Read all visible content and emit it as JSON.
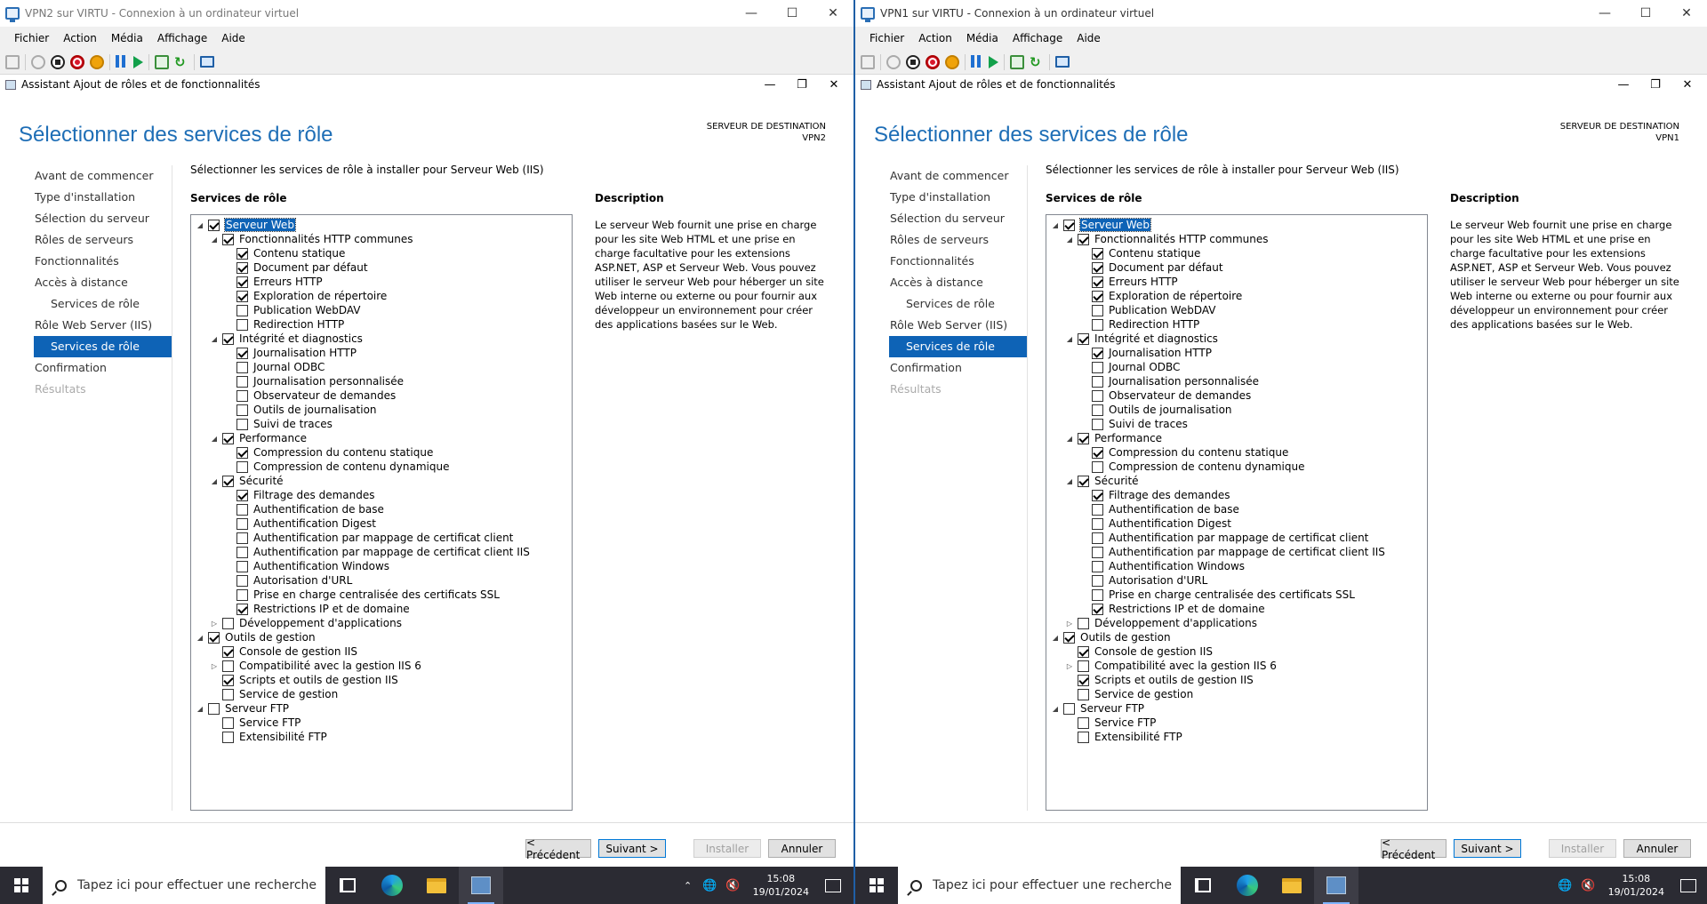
{
  "left": {
    "window_title": "VPN2 sur VIRTU - Connexion à un ordinateur virtuel",
    "menu": [
      "Fichier",
      "Action",
      "Média",
      "Affichage",
      "Aide"
    ],
    "wizard_title": "Assistant Ajout de rôles et de fonctionnalités",
    "page_title": "Sélectionner des services de rôle",
    "dest_label": "SERVEUR DE DESTINATION",
    "dest_server": "VPN2",
    "instruction": "Sélectionner les services de rôle à installer pour Serveur Web (IIS)",
    "services_label": "Services de rôle",
    "description_label": "Description",
    "description_text": "Le serveur Web fournit une prise en charge pour les site Web HTML et une prise en charge facultative pour les extensions ASP.NET, ASP et Serveur Web. Vous pouvez utiliser le serveur Web pour héberger un site Web interne ou externe ou pour fournir aux développeur un environnement pour créer des applications basées sur le Web.",
    "buttons": {
      "prev": "< Précédent",
      "next": "Suivant >",
      "install": "Installer",
      "cancel": "Annuler"
    },
    "search_placeholder": "Tapez ici pour effectuer une recherche",
    "time": "15:08",
    "date": "19/01/2024"
  },
  "right": {
    "window_title": "VPN1 sur VIRTU - Connexion à un ordinateur virtuel",
    "menu": [
      "Fichier",
      "Action",
      "Média",
      "Affichage",
      "Aide"
    ],
    "wizard_title": "Assistant Ajout de rôles et de fonctionnalités",
    "page_title": "Sélectionner des services de rôle",
    "dest_label": "SERVEUR DE DESTINATION",
    "dest_server": "VPN1",
    "instruction": "Sélectionner les services de rôle à installer pour Serveur Web (IIS)",
    "services_label": "Services de rôle",
    "description_label": "Description",
    "description_text": "Le serveur Web fournit une prise en charge pour les site Web HTML et une prise en charge facultative pour les extensions ASP.NET, ASP et Serveur Web. Vous pouvez utiliser le serveur Web pour héberger un site Web interne ou externe ou pour fournir aux développeur un environnement pour créer des applications basées sur le Web.",
    "buttons": {
      "prev": "< Précédent",
      "next": "Suivant >",
      "install": "Installer",
      "cancel": "Annuler"
    },
    "search_placeholder": "Tapez ici pour effectuer une recherche",
    "time": "15:08",
    "date": "19/01/2024"
  },
  "nav": [
    {
      "label": "Avant de commencer",
      "state": "normal",
      "indent": 0
    },
    {
      "label": "Type d'installation",
      "state": "normal",
      "indent": 0
    },
    {
      "label": "Sélection du serveur",
      "state": "normal",
      "indent": 0
    },
    {
      "label": "Rôles de serveurs",
      "state": "normal",
      "indent": 0
    },
    {
      "label": "Fonctionnalités",
      "state": "normal",
      "indent": 0
    },
    {
      "label": "Accès à distance",
      "state": "normal",
      "indent": 0
    },
    {
      "label": "Services de rôle",
      "state": "normal",
      "indent": 1
    },
    {
      "label": "Rôle Web Server (IIS)",
      "state": "normal",
      "indent": 0
    },
    {
      "label": "Services de rôle",
      "state": "selected",
      "indent": 1
    },
    {
      "label": "Confirmation",
      "state": "normal",
      "indent": 0
    },
    {
      "label": "Résultats",
      "state": "disabled",
      "indent": 0
    }
  ],
  "tree": [
    {
      "label": "Serveur Web",
      "level": 0,
      "checked": true,
      "expander": "expanded",
      "highlight": true
    },
    {
      "label": "Fonctionnalités HTTP communes",
      "level": 1,
      "checked": true,
      "expander": "expanded"
    },
    {
      "label": "Contenu statique",
      "level": 2,
      "checked": true
    },
    {
      "label": "Document par défaut",
      "level": 2,
      "checked": true
    },
    {
      "label": "Erreurs HTTP",
      "level": 2,
      "checked": true
    },
    {
      "label": "Exploration de répertoire",
      "level": 2,
      "checked": true
    },
    {
      "label": "Publication WebDAV",
      "level": 2,
      "checked": false
    },
    {
      "label": "Redirection HTTP",
      "level": 2,
      "checked": false
    },
    {
      "label": "Intégrité et diagnostics",
      "level": 1,
      "checked": true,
      "expander": "expanded"
    },
    {
      "label": "Journalisation HTTP",
      "level": 2,
      "checked": true
    },
    {
      "label": "Journal ODBC",
      "level": 2,
      "checked": false
    },
    {
      "label": "Journalisation personnalisée",
      "level": 2,
      "checked": false
    },
    {
      "label": "Observateur de demandes",
      "level": 2,
      "checked": false
    },
    {
      "label": "Outils de journalisation",
      "level": 2,
      "checked": false
    },
    {
      "label": "Suivi de traces",
      "level": 2,
      "checked": false
    },
    {
      "label": "Performance",
      "level": 1,
      "checked": true,
      "expander": "expanded"
    },
    {
      "label": "Compression du contenu statique",
      "level": 2,
      "checked": true
    },
    {
      "label": "Compression de contenu dynamique",
      "level": 2,
      "checked": false
    },
    {
      "label": "Sécurité",
      "level": 1,
      "checked": true,
      "expander": "expanded"
    },
    {
      "label": "Filtrage des demandes",
      "level": 2,
      "checked": true
    },
    {
      "label": "Authentification de base",
      "level": 2,
      "checked": false
    },
    {
      "label": "Authentification Digest",
      "level": 2,
      "checked": false
    },
    {
      "label": "Authentification par mappage de certificat client",
      "level": 2,
      "checked": false
    },
    {
      "label": "Authentification par mappage de certificat client IIS",
      "level": 2,
      "checked": false
    },
    {
      "label": "Authentification Windows",
      "level": 2,
      "checked": false
    },
    {
      "label": "Autorisation d'URL",
      "level": 2,
      "checked": false
    },
    {
      "label": "Prise en charge centralisée des certificats SSL",
      "level": 2,
      "checked": false
    },
    {
      "label": "Restrictions IP et de domaine",
      "level": 2,
      "checked": true
    },
    {
      "label": "Développement d'applications",
      "level": 1,
      "checked": false,
      "expander": "collapsed"
    },
    {
      "label": "Outils de gestion",
      "level": 0,
      "checked": true,
      "expander": "expanded"
    },
    {
      "label": "Console de gestion IIS",
      "level": 1,
      "checked": true
    },
    {
      "label": "Compatibilité avec la gestion IIS 6",
      "level": 1,
      "checked": false,
      "expander": "collapsed"
    },
    {
      "label": "Scripts et outils de gestion IIS",
      "level": 1,
      "checked": true
    },
    {
      "label": "Service de gestion",
      "level": 1,
      "checked": false
    },
    {
      "label": "Serveur FTP",
      "level": 0,
      "checked": false,
      "expander": "expanded"
    },
    {
      "label": "Service FTP",
      "level": 1,
      "checked": false
    },
    {
      "label": "Extensibilité FTP",
      "level": 1,
      "checked": false
    }
  ],
  "colors": {
    "title_blue": "#1e6eb6",
    "selection": "#0e63b6",
    "taskbar": "#2b2b33"
  }
}
